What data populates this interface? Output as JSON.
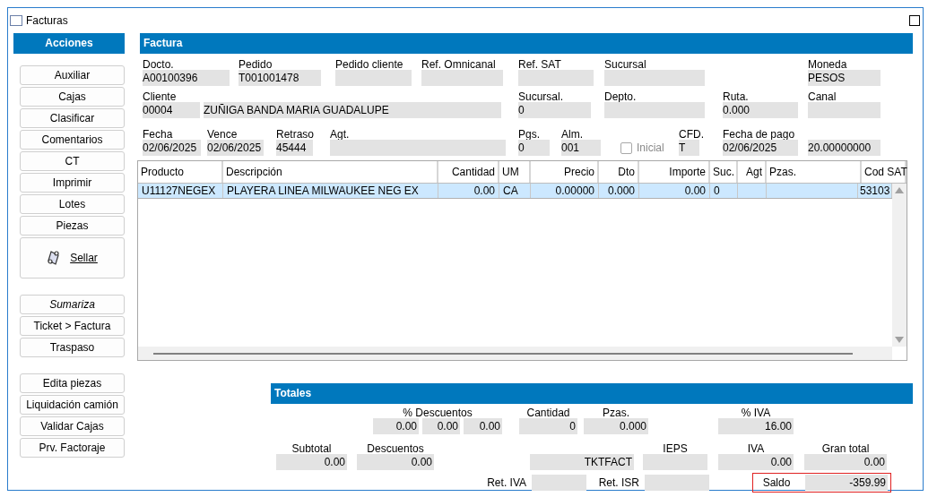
{
  "window": {
    "title": "Facturas"
  },
  "actions": {
    "title": "Acciones",
    "groups": [
      [
        {
          "label": "Auxiliar",
          "kind": "plain"
        },
        {
          "label": "Cajas",
          "kind": "plain"
        },
        {
          "label": "Clasificar",
          "kind": "plain"
        },
        {
          "label": "Comentarios",
          "kind": "plain"
        },
        {
          "label": "CT",
          "kind": "plain"
        },
        {
          "label": "Imprimir",
          "kind": "plain"
        },
        {
          "label": "Lotes",
          "kind": "plain"
        },
        {
          "label": "Piezas",
          "kind": "plain"
        },
        {
          "label": "Sellar",
          "kind": "icon"
        }
      ],
      [
        {
          "label": "Sumariza",
          "kind": "italic"
        },
        {
          "label": "Ticket > Factura",
          "kind": "plain"
        },
        {
          "label": "Traspaso",
          "kind": "plain"
        }
      ],
      [
        {
          "label": "Edita piezas",
          "kind": "plain"
        },
        {
          "label": "Liquidación camión",
          "kind": "plain"
        },
        {
          "label": "Validar Cajas",
          "kind": "plain"
        },
        {
          "label": "Prv. Factoraje",
          "kind": "plain"
        }
      ]
    ]
  },
  "factura": {
    "title": "Factura",
    "fields": [
      {
        "kind": "field",
        "label": "Docto.",
        "value": "A00100396"
      },
      {
        "kind": "field",
        "label": "Pedido",
        "value": "T001001478"
      },
      {
        "kind": "field",
        "label": "Pedido cliente"
      },
      {
        "kind": "field",
        "label": "Ref. Omnicanal"
      },
      {
        "kind": "field",
        "label": "Ref. SAT"
      },
      {
        "kind": "field",
        "label": "Sucursal"
      },
      {
        "kind": "field",
        "label": "Moneda",
        "value": "PESOS"
      },
      {
        "kind": "field",
        "label": "Cliente",
        "value": "00004"
      },
      {
        "kind": "field",
        "value": "ZUÑIGA BANDA MARIA GUADALUPE"
      },
      {
        "kind": "field",
        "label": "Sucursal.",
        "value": "0"
      },
      {
        "kind": "field",
        "label": "Depto."
      },
      {
        "kind": "field",
        "label": "Ruta.",
        "value": "0.000"
      },
      {
        "kind": "field",
        "label": "Canal"
      },
      {
        "kind": "field",
        "label": "Fecha",
        "value": "02/06/2025"
      },
      {
        "kind": "field",
        "label": "Vence",
        "value": "02/06/2025"
      },
      {
        "kind": "field",
        "label": "Retraso",
        "value": "45444"
      },
      {
        "kind": "field",
        "label": "Agt."
      },
      {
        "kind": "field",
        "label": "Pgs.",
        "value": "0"
      },
      {
        "kind": "field",
        "label": "Alm.",
        "value": "001"
      },
      {
        "kind": "checkbox",
        "label": "Inicial",
        "checked": false,
        "disabled": true
      },
      {
        "kind": "field",
        "label": "CFD.",
        "value": "T"
      },
      {
        "kind": "field",
        "label": "Fecha de pago",
        "value": "02/06/2025"
      },
      {
        "kind": "field",
        "value": "20.00000000"
      }
    ]
  },
  "table": {
    "columns": [
      "Producto",
      "Descripción",
      "Cantidad",
      "UM",
      "Precio",
      "Dto",
      "Importe",
      "Suc.",
      "Agt",
      "Pzas.",
      "Cod SAT"
    ],
    "rows": [
      {
        "selected": true,
        "cells": [
          "U11127NEGEX",
          "PLAYERA LINEA MILWAUKEE NEG EX",
          "0.00",
          "CA",
          "0.00000",
          "0.000",
          "0.00",
          "0",
          "",
          "",
          "53103"
        ]
      }
    ]
  },
  "totales": {
    "title": "Totales",
    "fields": [
      {
        "kind": "group",
        "label": "% Descuentos",
        "values": [
          "0.00",
          "0.00",
          "0.00"
        ]
      },
      {
        "kind": "field",
        "label": "Cantidad",
        "value": "0"
      },
      {
        "kind": "field",
        "label": "Pzas.",
        "value": "0.000"
      },
      {
        "kind": "field",
        "label": "% IVA",
        "value": "16.00"
      },
      {
        "kind": "field",
        "label": "Subtotal",
        "value": "0.00"
      },
      {
        "kind": "field",
        "label": "Descuentos",
        "value": "0.00"
      },
      {
        "kind": "field",
        "value": "TKTFACT"
      },
      {
        "kind": "field",
        "label": "IEPS"
      },
      {
        "kind": "field",
        "label": "IVA",
        "value": "0.00"
      },
      {
        "kind": "field",
        "label": "Gran total",
        "value": "0.00"
      },
      {
        "kind": "inline",
        "label": "Ret. IVA",
        "highlighted": false
      },
      {
        "kind": "inline",
        "label": "Ret. ISR",
        "highlighted": false
      },
      {
        "kind": "inline",
        "label": "Saldo",
        "value": "-359.99",
        "highlighted": true
      }
    ]
  }
}
